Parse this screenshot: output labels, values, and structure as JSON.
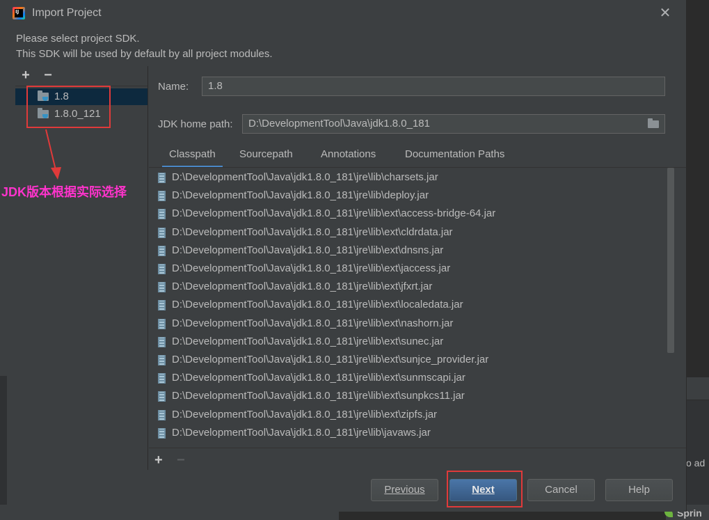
{
  "dialog": {
    "title": "Import Project",
    "app_icon": "intellij-idea-icon",
    "close_icon": "close-icon",
    "message_line1": "Please select project SDK.",
    "message_line2": "This SDK will be used by default by all project modules."
  },
  "sdk_list": {
    "add_label": "+",
    "remove_label": "−",
    "items": [
      {
        "label": "1.8",
        "selected": true,
        "icon": "jdk-folder-icon"
      },
      {
        "label": "1.8.0_121",
        "selected": false,
        "icon": "jdk-folder-icon"
      }
    ]
  },
  "annotation": {
    "text": "JDK版本根据实际选择",
    "color": "#ff33cc",
    "box_color": "#e03a3a"
  },
  "form": {
    "name_label": "Name:",
    "name_value": "1.8",
    "home_label": "JDK home path:",
    "home_value": "D:\\DevelopmentTool\\Java\\jdk1.8.0_181",
    "browse_icon": "folder-open-icon"
  },
  "tabs": [
    {
      "label": "Classpath",
      "active": true
    },
    {
      "label": "Sourcepath",
      "active": false
    },
    {
      "label": "Annotations",
      "active": false
    },
    {
      "label": "Documentation Paths",
      "active": false
    }
  ],
  "classpath": [
    "D:\\DevelopmentTool\\Java\\jdk1.8.0_181\\jre\\lib\\charsets.jar",
    "D:\\DevelopmentTool\\Java\\jdk1.8.0_181\\jre\\lib\\deploy.jar",
    "D:\\DevelopmentTool\\Java\\jdk1.8.0_181\\jre\\lib\\ext\\access-bridge-64.jar",
    "D:\\DevelopmentTool\\Java\\jdk1.8.0_181\\jre\\lib\\ext\\cldrdata.jar",
    "D:\\DevelopmentTool\\Java\\jdk1.8.0_181\\jre\\lib\\ext\\dnsns.jar",
    "D:\\DevelopmentTool\\Java\\jdk1.8.0_181\\jre\\lib\\ext\\jaccess.jar",
    "D:\\DevelopmentTool\\Java\\jdk1.8.0_181\\jre\\lib\\ext\\jfxrt.jar",
    "D:\\DevelopmentTool\\Java\\jdk1.8.0_181\\jre\\lib\\ext\\localedata.jar",
    "D:\\DevelopmentTool\\Java\\jdk1.8.0_181\\jre\\lib\\ext\\nashorn.jar",
    "D:\\DevelopmentTool\\Java\\jdk1.8.0_181\\jre\\lib\\ext\\sunec.jar",
    "D:\\DevelopmentTool\\Java\\jdk1.8.0_181\\jre\\lib\\ext\\sunjce_provider.jar",
    "D:\\DevelopmentTool\\Java\\jdk1.8.0_181\\jre\\lib\\ext\\sunmscapi.jar",
    "D:\\DevelopmentTool\\Java\\jdk1.8.0_181\\jre\\lib\\ext\\sunpkcs11.jar",
    "D:\\DevelopmentTool\\Java\\jdk1.8.0_181\\jre\\lib\\ext\\zipfs.jar",
    "D:\\DevelopmentTool\\Java\\jdk1.8.0_181\\jre\\lib\\javaws.jar"
  ],
  "list_tools": {
    "add_label": "+",
    "remove_label": "−"
  },
  "buttons": {
    "previous": "Previous",
    "next": "Next",
    "cancel": "Cancel",
    "help": "Help"
  },
  "background": {
    "partial_text": "o ad",
    "spring_text": "Sprin"
  }
}
